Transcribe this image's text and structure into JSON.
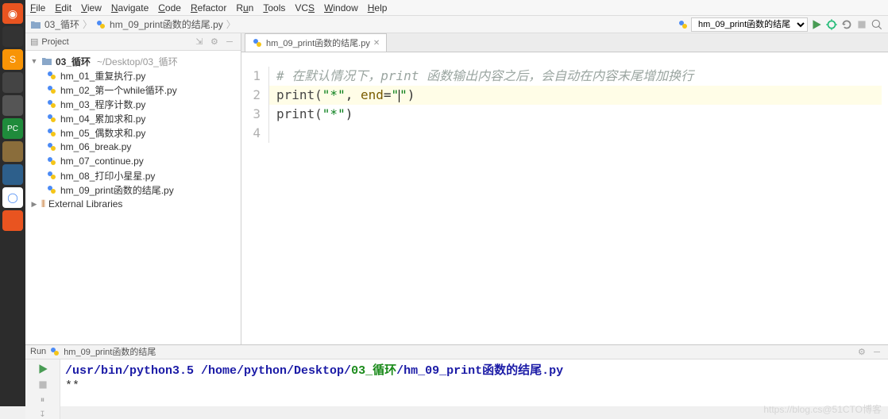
{
  "menu": [
    "File",
    "Edit",
    "View",
    "Navigate",
    "Code",
    "Refactor",
    "Run",
    "Tools",
    "VCS",
    "Window",
    "Help"
  ],
  "breadcrumb": {
    "folder": "03_循环",
    "file": "hm_09_print函数的结尾.py"
  },
  "runconfig": {
    "selected": "hm_09_print函数的结尾"
  },
  "project": {
    "title": "Project",
    "root": {
      "name": "03_循环",
      "path": "~/Desktop/03_循环"
    },
    "items": [
      {
        "name": "hm_01_重复执行.py"
      },
      {
        "name": "hm_02_第一个while循环.py"
      },
      {
        "name": "hm_03_程序计数.py"
      },
      {
        "name": "hm_04_累加求和.py"
      },
      {
        "name": "hm_05_偶数求和.py"
      },
      {
        "name": "hm_06_break.py"
      },
      {
        "name": "hm_07_continue.py"
      },
      {
        "name": "hm_08_打印小星星.py"
      },
      {
        "name": "hm_09_print函数的结尾.py"
      }
    ],
    "external": "External Libraries"
  },
  "tab": {
    "label": "hm_09_print函数的结尾.py"
  },
  "code": {
    "lines": [
      "1",
      "2",
      "3",
      "4"
    ],
    "l1_comment": "# 在默认情况下，print 函数输出内容之后，会自动在内容末尾增加换行",
    "l2_pre": "print(",
    "l2_s1": "\"*\"",
    "l2_mid": ", ",
    "l2_end_kw": "end",
    "l2_eq": "=",
    "l2_s2a": "\"",
    "l2_s2b": "\"",
    "l2_post": ")",
    "l3_pre": "print(",
    "l3_s1": "\"*\"",
    "l3_post": ")"
  },
  "run": {
    "label": "Run",
    "script": "hm_09_print函数的结尾",
    "cmd_interp": "/usr/bin/python3.5 ",
    "cmd_path_prefix": "/home/python/Desktop/",
    "cmd_path_green": "03_循环",
    "cmd_path_suffix": "/hm_09_print函数的结尾.py",
    "output": "**"
  },
  "watermark": "https://blog.cs@51CTO博客"
}
